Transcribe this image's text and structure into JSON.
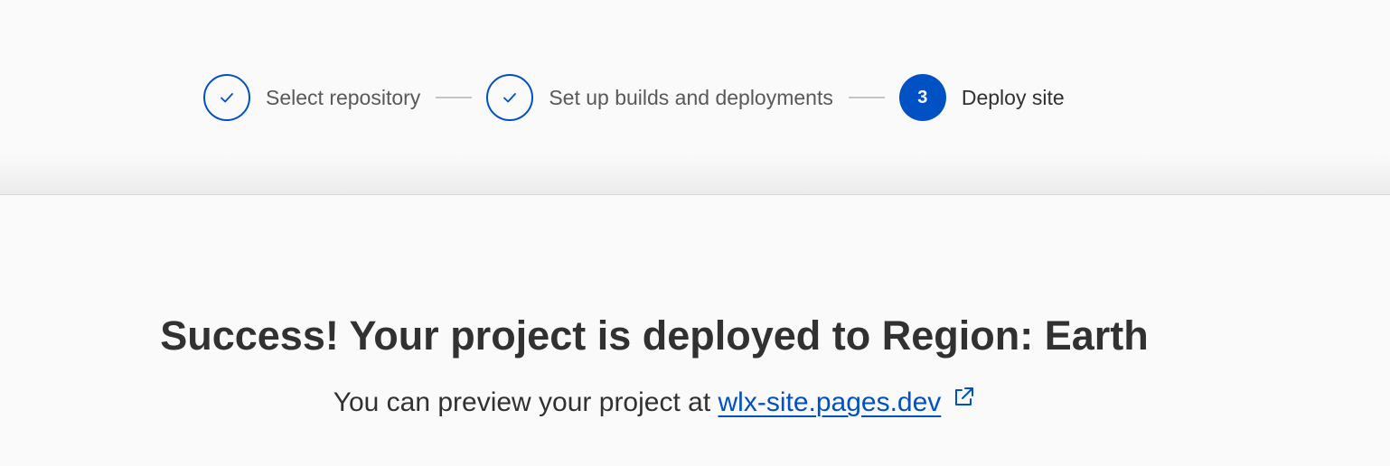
{
  "stepper": {
    "steps": [
      {
        "label": "Select repository",
        "status": "complete",
        "icon": "check-icon"
      },
      {
        "label": "Set up builds and deployments",
        "status": "complete",
        "icon": "check-icon"
      },
      {
        "label": "Deploy site",
        "status": "current",
        "number": "3"
      }
    ]
  },
  "main": {
    "title": "Success! Your project is deployed to Region: Earth",
    "preview_prefix": "You can preview your project at ",
    "preview_link": "wlx-site.pages.dev",
    "preview_link_icon": "external-link-icon"
  },
  "colors": {
    "accent": "#0051c3",
    "text": "#313131",
    "muted_text": "#595959",
    "background": "#fafafa"
  }
}
